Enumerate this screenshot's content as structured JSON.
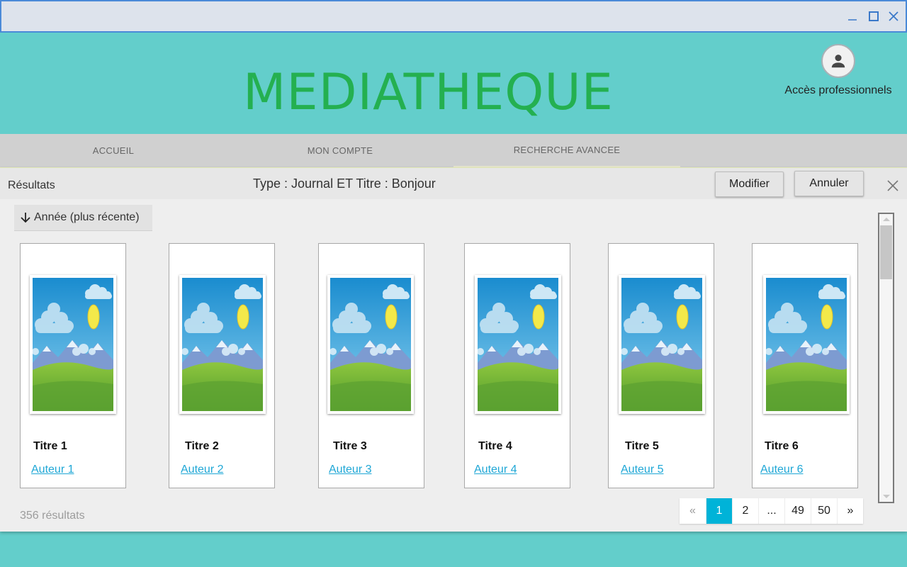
{
  "window": {
    "controls": [
      "minimize-icon",
      "maximize-icon",
      "close-icon"
    ]
  },
  "header": {
    "title": "MEDIATHEQUE",
    "pro_access_label": "Accès professionnels",
    "pro_access_icon": "user-icon"
  },
  "nav": {
    "items": [
      {
        "label": "ACCUEIL",
        "active": false
      },
      {
        "label": "MON COMPTE",
        "active": false
      },
      {
        "label": "RECHERCHE AVANCEE",
        "active": true
      }
    ]
  },
  "results": {
    "label": "Résultats",
    "query": "Type : Journal ET Titre : Bonjour",
    "modify_label": "Modifier",
    "cancel_label": "Annuler",
    "sort_label": "Année (plus récente)",
    "sort_icon": "arrow-down-icon",
    "count_text": "356 résultats",
    "items": [
      {
        "title": "Titre 1",
        "author": "Auteur 1"
      },
      {
        "title": "Titre 2",
        "author": "Auteur 2"
      },
      {
        "title": "Titre 3",
        "author": "Auteur 3"
      },
      {
        "title": "Titre 4",
        "author": "Auteur 4"
      },
      {
        "title": "Titre 5",
        "author": "Auteur 5"
      },
      {
        "title": "Titre 6",
        "author": "Auteur 6"
      }
    ]
  },
  "pagination": {
    "prev": "«",
    "pages": [
      "1",
      "2",
      "...",
      "49",
      "50"
    ],
    "current": "1",
    "next": "»"
  },
  "colors": {
    "background": "#63cecb",
    "title": "#24b050",
    "accent": "#00b3d8",
    "author_link": "#1fa7d6"
  }
}
